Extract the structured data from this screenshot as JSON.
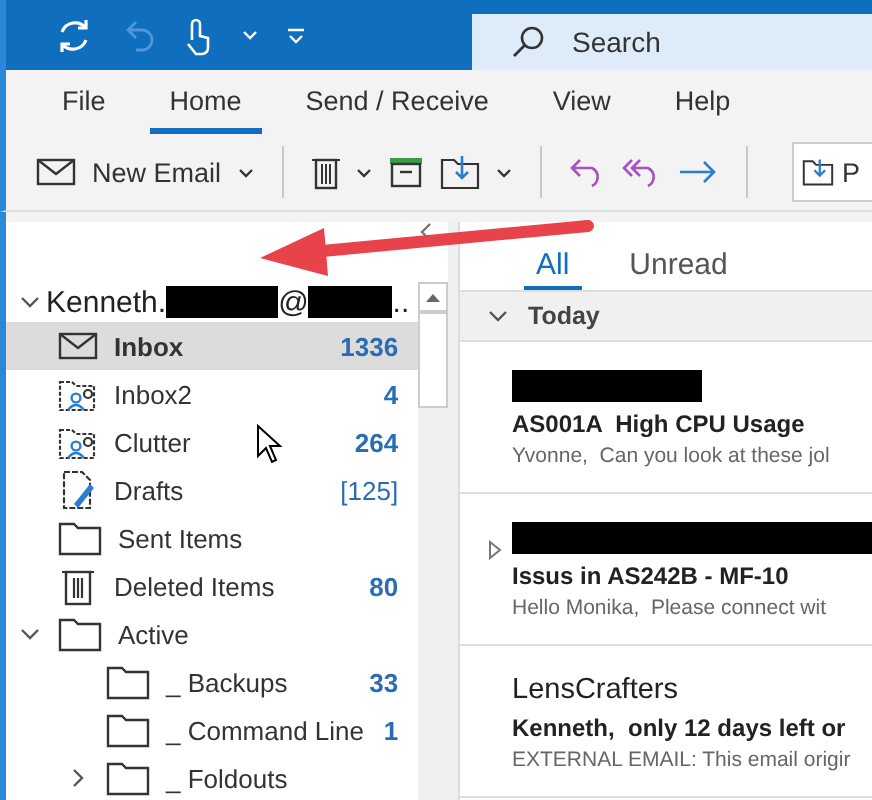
{
  "title_bar": {
    "search": {
      "placeholder": "Search"
    }
  },
  "menu": [
    {
      "label": "File",
      "selected": false
    },
    {
      "label": "Home",
      "selected": true
    },
    {
      "label": "Send / Receive",
      "selected": false
    },
    {
      "label": "View",
      "selected": false
    },
    {
      "label": "Help",
      "selected": false
    }
  ],
  "ribbon": {
    "new_email": "New Email",
    "cut_button": "P"
  },
  "folder_pane": {
    "account": [
      {
        "kind": "text",
        "text": "Kenneth."
      },
      {
        "kind": "redacted"
      },
      {
        "kind": "text",
        "text": "@"
      },
      {
        "kind": "redacted"
      },
      {
        "kind": "text",
        "text": ".."
      }
    ],
    "folders": [
      {
        "label": "Inbox",
        "count": "1336",
        "kind": "mail",
        "selected": true
      },
      {
        "label": "Inbox2",
        "count": "4",
        "kind": "shared",
        "selected": false
      },
      {
        "label": "Clutter",
        "count": "264",
        "kind": "shared",
        "selected": false
      },
      {
        "label": "Drafts",
        "count": "[125]",
        "kind": "drafts",
        "selected": false
      },
      {
        "label": "Sent Items",
        "kind": "folder",
        "selected": false
      },
      {
        "label": "Deleted Items",
        "count": "80",
        "kind": "trash",
        "selected": false
      },
      {
        "label": "Active",
        "kind": "folder",
        "selected": false,
        "expanded": true,
        "children": [
          {
            "label": "_ Backups",
            "count": "33",
            "kind": "folder",
            "selected": false
          },
          {
            "label": "_ Command Line",
            "count": "1",
            "kind": "folder",
            "selected": false
          },
          {
            "label": "_ Foldouts",
            "kind": "folder",
            "selected": false,
            "expanded": false
          }
        ]
      }
    ]
  },
  "message_list": {
    "tabs": [
      {
        "label": "All",
        "selected": true
      },
      {
        "label": "Unread",
        "selected": false
      }
    ],
    "group": "Today",
    "messages": [
      {
        "sender_redacted": true,
        "thread": false,
        "subject": "AS001A  High CPU Usage",
        "preview": "Yvonne,  Can you look at these jol"
      },
      {
        "sender_redacted": true,
        "thread": true,
        "subject": "Issus in AS242B - MF-10",
        "preview": "Hello Monika,  Please connect wit"
      },
      {
        "sender_redacted": false,
        "sender": "LensCrafters",
        "thread": false,
        "subject": "Kenneth,  only 12 days left or",
        "preview": "EXTERNAL EMAIL: This email origir"
      }
    ]
  }
}
